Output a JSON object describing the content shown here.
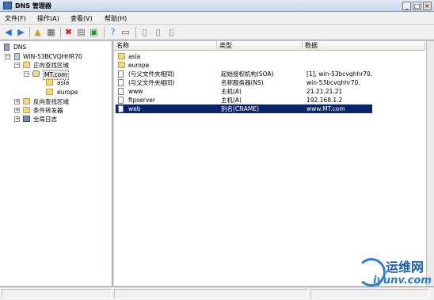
{
  "window": {
    "title": "DNS 管理器",
    "min": "_",
    "max": "□",
    "close": "×"
  },
  "menu": [
    "文件(F)",
    "操作(A)",
    "查看(V)",
    "帮助(H)"
  ],
  "tree": {
    "root": "DNS",
    "server": "WIN-53BCVQHHR70",
    "forward_zone": "正向查找区域",
    "zone": "MT.com",
    "sub1": "asia",
    "sub2": "europe",
    "reverse_zone": "反向查找区域",
    "conditional": "条件转发器",
    "logs": "全局日志"
  },
  "list": {
    "columns": [
      "名称",
      "类型",
      "数据"
    ],
    "rows": [
      {
        "name": "asia",
        "type": "",
        "data": "",
        "icon": "folder"
      },
      {
        "name": "europe",
        "type": "",
        "data": "",
        "icon": "folder"
      },
      {
        "name": "(与父文件夹相同)",
        "type": "起始授权机构(SOA)",
        "data": "[1], win-53bcvqhhr70....",
        "icon": "record"
      },
      {
        "name": "(与父文件夹相同)",
        "type": "名称服务器(NS)",
        "data": "win-53bcvqhhr70.",
        "icon": "record"
      },
      {
        "name": "www",
        "type": "主机(A)",
        "data": "21.21.21.21",
        "icon": "record"
      },
      {
        "name": "ftpserver",
        "type": "主机(A)",
        "data": "192.168.1.2",
        "icon": "record"
      },
      {
        "name": "web",
        "type": "别名(CNAME)",
        "data": "www.MT.com",
        "icon": "record",
        "selected": true
      }
    ]
  },
  "watermark": {
    "cn": "运维网",
    "en": "iyunv.com"
  },
  "colors": {
    "selection": "#0a246a",
    "watermark": "#1f7bd5"
  }
}
